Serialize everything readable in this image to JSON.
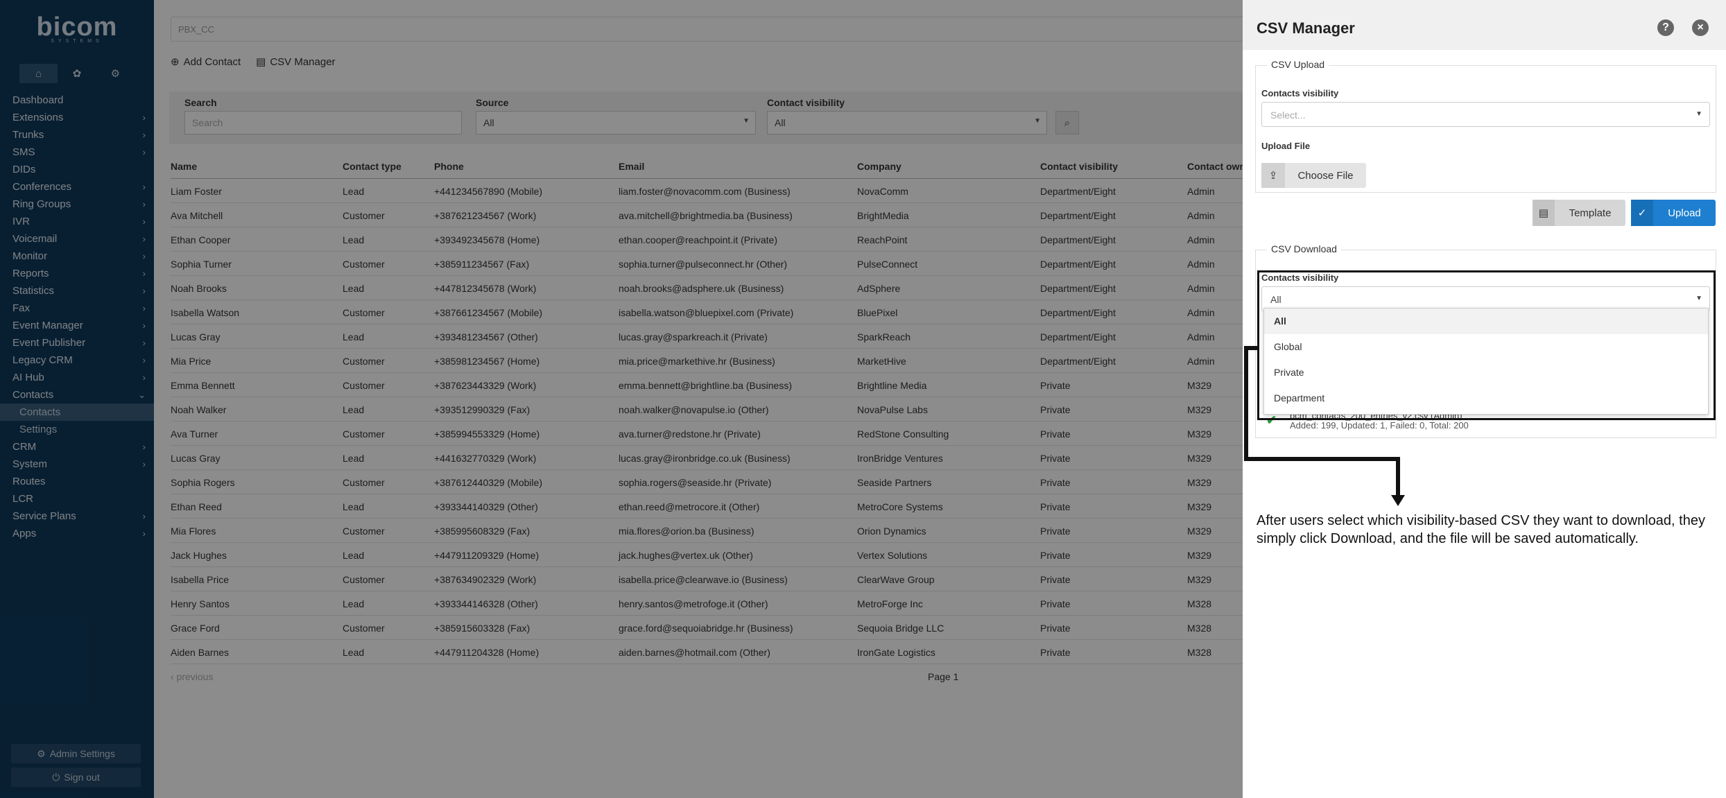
{
  "app": {
    "logo": "bicom",
    "logo_sub": "SYSTEMS"
  },
  "sidebar": {
    "tabs": [
      {
        "icon": "home-icon",
        "glyph": "⌂"
      },
      {
        "icon": "palette-icon",
        "glyph": "✿"
      },
      {
        "icon": "gears-icon",
        "glyph": "⚙"
      }
    ],
    "items": [
      {
        "label": "Dashboard",
        "chevron": ""
      },
      {
        "label": "Extensions",
        "chevron": "›"
      },
      {
        "label": "Trunks",
        "chevron": "›"
      },
      {
        "label": "SMS",
        "chevron": "›"
      },
      {
        "label": "DIDs",
        "chevron": ""
      },
      {
        "label": "Conferences",
        "chevron": "›"
      },
      {
        "label": "Ring Groups",
        "chevron": "›"
      },
      {
        "label": "IVR",
        "chevron": "›"
      },
      {
        "label": "Voicemail",
        "chevron": "›"
      },
      {
        "label": "Monitor",
        "chevron": "›"
      },
      {
        "label": "Reports",
        "chevron": "›"
      },
      {
        "label": "Statistics",
        "chevron": "›"
      },
      {
        "label": "Fax",
        "chevron": "›"
      },
      {
        "label": "Event Manager",
        "chevron": "›"
      },
      {
        "label": "Event Publisher",
        "chevron": "›"
      },
      {
        "label": "Legacy CRM",
        "chevron": "›"
      },
      {
        "label": "AI Hub",
        "chevron": "›"
      },
      {
        "label": "Contacts",
        "chevron": "⌄"
      }
    ],
    "sub_items": [
      {
        "label": "Contacts"
      },
      {
        "label": "Settings"
      }
    ],
    "items_after": [
      {
        "label": "CRM",
        "chevron": "›"
      },
      {
        "label": "System",
        "chevron": "›"
      },
      {
        "label": "Routes",
        "chevron": ""
      },
      {
        "label": "LCR",
        "chevron": ""
      },
      {
        "label": "Service Plans",
        "chevron": "›"
      },
      {
        "label": "Apps",
        "chevron": "›"
      }
    ],
    "admin_settings": "Admin Settings",
    "sign_out": "Sign out"
  },
  "main": {
    "tenant": "PBX_CC",
    "toolbar": {
      "add_contact": "Add Contact",
      "csv_manager": "CSV Manager"
    },
    "filters": {
      "search_label": "Search",
      "search_placeholder": "Search",
      "source_label": "Source",
      "source_value": "All",
      "visibility_label": "Contact visibility",
      "visibility_value": "All"
    },
    "table": {
      "headers": [
        "Name",
        "Contact type",
        "Phone",
        "Email",
        "Company",
        "Contact visibility",
        "Contact own"
      ],
      "rows": [
        [
          "Liam Foster",
          "Lead",
          "+441234567890 (Mobile)",
          "liam.foster@novacomm.com (Business)",
          "NovaComm",
          "Department/Eight",
          "Admin"
        ],
        [
          "Ava Mitchell",
          "Customer",
          "+387621234567 (Work)",
          "ava.mitchell@brightmedia.ba (Business)",
          "BrightMedia",
          "Department/Eight",
          "Admin"
        ],
        [
          "Ethan Cooper",
          "Lead",
          "+393492345678 (Home)",
          "ethan.cooper@reachpoint.it (Private)",
          "ReachPoint",
          "Department/Eight",
          "Admin"
        ],
        [
          "Sophia Turner",
          "Customer",
          "+385911234567 (Fax)",
          "sophia.turner@pulseconnect.hr (Other)",
          "PulseConnect",
          "Department/Eight",
          "Admin"
        ],
        [
          "Noah Brooks",
          "Lead",
          "+447812345678 (Work)",
          "noah.brooks@adsphere.uk (Business)",
          "AdSphere",
          "Department/Eight",
          "Admin"
        ],
        [
          "Isabella Watson",
          "Customer",
          "+387661234567 (Mobile)",
          "isabella.watson@bluepixel.com (Private)",
          "BluePixel",
          "Department/Eight",
          "Admin"
        ],
        [
          "Lucas Gray",
          "Lead",
          "+393481234567 (Other)",
          "lucas.gray@sparkreach.it (Private)",
          "SparkReach",
          "Department/Eight",
          "Admin"
        ],
        [
          "Mia Price",
          "Customer",
          "+385981234567 (Home)",
          "mia.price@markethive.hr (Business)",
          "MarketHive",
          "Department/Eight",
          "Admin"
        ],
        [
          "Emma Bennett",
          "Customer",
          "+387623443329 (Work)",
          "emma.bennett@brightline.ba (Business)",
          "Brightline Media",
          "Private",
          "M329"
        ],
        [
          "Noah Walker",
          "Lead",
          "+393512990329 (Fax)",
          "noah.walker@novapulse.io (Other)",
          "NovaPulse Labs",
          "Private",
          "M329"
        ],
        [
          "Ava Turner",
          "Customer",
          "+385994553329 (Home)",
          "ava.turner@redstone.hr (Private)",
          "RedStone Consulting",
          "Private",
          "M329"
        ],
        [
          "Lucas Gray",
          "Lead",
          "+441632770329 (Work)",
          "lucas.gray@ironbridge.co.uk (Business)",
          "IronBridge Ventures",
          "Private",
          "M329"
        ],
        [
          "Sophia Rogers",
          "Customer",
          "+387612440329 (Mobile)",
          "sophia.rogers@seaside.hr (Private)",
          "Seaside Partners",
          "Private",
          "M329"
        ],
        [
          "Ethan Reed",
          "Lead",
          "+393344140329 (Other)",
          "ethan.reed@metrocore.it (Other)",
          "MetroCore Systems",
          "Private",
          "M329"
        ],
        [
          "Mia Flores",
          "Customer",
          "+385995608329 (Fax)",
          "mia.flores@orion.ba (Business)",
          "Orion Dynamics",
          "Private",
          "M329"
        ],
        [
          "Jack Hughes",
          "Lead",
          "+447911209329 (Home)",
          "jack.hughes@vertex.uk (Other)",
          "Vertex Solutions",
          "Private",
          "M329"
        ],
        [
          "Isabella Price",
          "Customer",
          "+387634902329 (Work)",
          "isabella.price@clearwave.io (Business)",
          "ClearWave Group",
          "Private",
          "M329"
        ],
        [
          "Henry Santos",
          "Lead",
          "+393344146328 (Other)",
          "henry.santos@metrofoge.it (Other)",
          "MetroForge Inc",
          "Private",
          "M328"
        ],
        [
          "Grace Ford",
          "Customer",
          "+385915603328 (Fax)",
          "grace.ford@sequoiabridge.hr (Business)",
          "Sequoia Bridge LLC",
          "Private",
          "M328"
        ],
        [
          "Aiden Barnes",
          "Lead",
          "+447911204328 (Home)",
          "aiden.barnes@hotmail.com (Other)",
          "IronGate Logistics",
          "Private",
          "M328"
        ]
      ]
    },
    "pager": {
      "previous": "‹ previous",
      "page": "Page 1"
    }
  },
  "csv_panel": {
    "title": "CSV Manager",
    "upload": {
      "legend": "CSV Upload",
      "visibility_label": "Contacts visibility",
      "visibility_placeholder": "Select...",
      "file_label": "Upload File",
      "choose_file": "Choose File",
      "template": "Template",
      "upload": "Upload"
    },
    "download": {
      "legend": "CSV Download",
      "visibility_label": "Contacts visibility",
      "visibility_value": "All",
      "options": [
        "All",
        "Global",
        "Private",
        "Department"
      ]
    },
    "last_upload": {
      "file": "bcm_contacts_200_entries_v2.csv (Admin)",
      "meta": "Added: 199, Updated: 1, Failed: 0, Total: 200"
    },
    "annotation": "After users select which visibility-based CSV they want to download, they simply click Download, and the file will be saved automatically."
  },
  "colors": {
    "sidebar": "#0f3a5c",
    "accent": "#1e7fd0",
    "success": "#2a9d3a"
  }
}
